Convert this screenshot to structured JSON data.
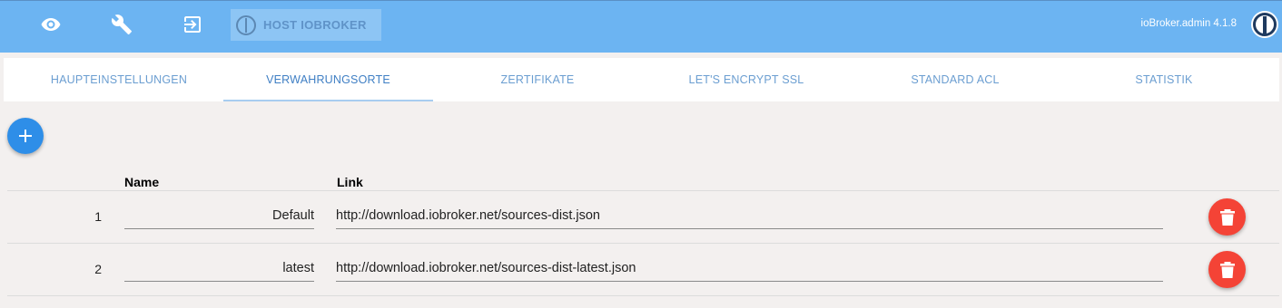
{
  "header": {
    "icons": [
      "eye-icon",
      "wrench-icon",
      "logout-icon"
    ],
    "host_label": "HOST IOBROKER",
    "version": "ioBroker.admin 4.1.8",
    "colors": {
      "bar": "#6cb4f2",
      "host_button": "#8dc5f4"
    }
  },
  "tabs": [
    {
      "label": "HAUPTEINSTELLUNGEN",
      "active": false
    },
    {
      "label": "VERWAHRUNGSORTE",
      "active": true
    },
    {
      "label": "ZERTIFIKATE",
      "active": false
    },
    {
      "label": "LET'S ENCRYPT SSL",
      "active": false
    },
    {
      "label": "STANDARD ACL",
      "active": false
    },
    {
      "label": "STATISTIK",
      "active": false
    }
  ],
  "toolbar": {
    "add_icon": "plus-icon",
    "add_color": "#2e8ee8"
  },
  "table": {
    "columns": [
      "Name",
      "Link"
    ],
    "rows": [
      {
        "index": "1",
        "name": "Default",
        "link": "http://download.iobroker.net/sources-dist.json"
      },
      {
        "index": "2",
        "name": "latest",
        "link": "http://download.iobroker.net/sources-dist-latest.json"
      }
    ],
    "delete_icon": "trash-icon",
    "delete_color": "#f44336"
  }
}
